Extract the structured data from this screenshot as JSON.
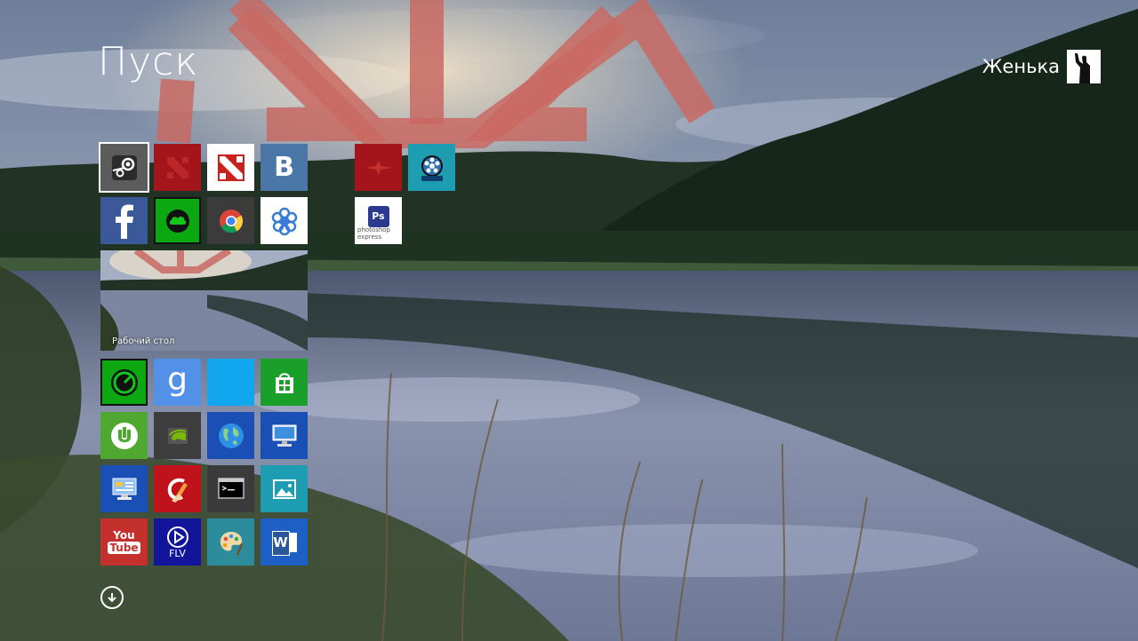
{
  "header": {
    "title": "Пуск"
  },
  "user": {
    "name": "Женька"
  },
  "desktop_tile": {
    "label": "Рабочий стол"
  },
  "tiles": {
    "vk_letter": "B",
    "flv_label": "FLV",
    "youtube_top": "You",
    "youtube_bottom": "Tube",
    "ps_caption": "photoshop express",
    "ps_badge": "Ps",
    "word_letter": "W"
  },
  "colors": {
    "steam": "#5c5c5c",
    "dota_red": "#a3151a",
    "vk": "#4a76a8",
    "facebook": "#3b5998",
    "green": "#0ba812",
    "teal": "#1e9db2",
    "sky": "#12a6ef",
    "store": "#1b9f2b",
    "utorrent": "#4fa82f",
    "nvidia": "#3d3d3d",
    "blue": "#1a4fb5",
    "ccleaner": "#c0121b",
    "cmd": "#3b3b3b",
    "youtube": "#c4302b",
    "flv": "#12149a",
    "paint": "#2d8c9c",
    "word": "#1d5fc5"
  }
}
